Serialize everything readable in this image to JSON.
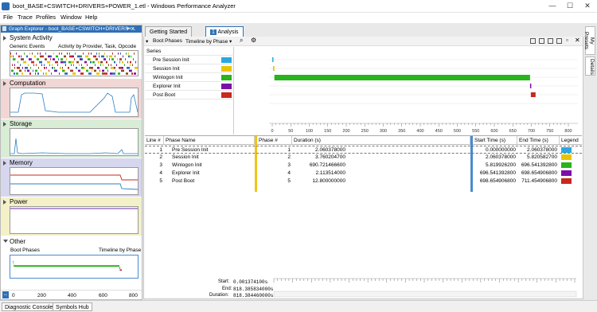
{
  "window": {
    "title": "boot_BASE+CSWITCH+DRIVERS+POWER_1.etl - Windows Performance Analyzer",
    "minimize": "—",
    "maximize": "☐",
    "close": "✕"
  },
  "menu": [
    "File",
    "Trace",
    "Profiles",
    "Window",
    "Help"
  ],
  "graph_explorer": {
    "title": "Graph Explorer - boot_BASE+CSWITCH+DRIVERS+...",
    "sections": {
      "system_activity": {
        "title": "System Activity",
        "sub_left": "Generic Events",
        "sub_right": "Activity by Provider, Task, Opcode"
      },
      "computation": {
        "title": "Computation"
      },
      "storage": {
        "title": "Storage"
      },
      "memory": {
        "title": "Memory"
      },
      "power": {
        "title": "Power"
      },
      "other": {
        "title": "Other",
        "graph_left": "Boot Phases",
        "graph_right": "Timeline by Phase"
      }
    },
    "axis_ticks": [
      "0",
      "200",
      "400",
      "600",
      "800"
    ]
  },
  "tabs": {
    "getting_started": "Getting Started",
    "analysis_num": "1",
    "analysis": "Analysis"
  },
  "graph": {
    "title": "Boot Phases",
    "preset": "Timeline by Phase",
    "series_header": "Series"
  },
  "series": [
    {
      "name": "Pre Session Init",
      "color": "#29a8e0"
    },
    {
      "name": "Session Init",
      "color": "#e8c400"
    },
    {
      "name": "Winlogon Init",
      "color": "#29b31c"
    },
    {
      "name": "Explorer Init",
      "color": "#7a10a8"
    },
    {
      "name": "Post Boot",
      "color": "#c8281e"
    }
  ],
  "chart_data": {
    "type": "bar",
    "title": "Boot Phases",
    "xlim": [
      0,
      800
    ],
    "x_ticks": [
      "0",
      "50",
      "100",
      "150",
      "200",
      "250",
      "300",
      "350",
      "400",
      "450",
      "500",
      "550",
      "600",
      "650",
      "700",
      "750",
      "800"
    ],
    "bars": [
      {
        "name": "Pre Session Init",
        "start": 0.0,
        "end": 2.060378
      },
      {
        "name": "Session Init",
        "start": 2.060378,
        "end": 5.820582
      },
      {
        "name": "Winlogon Init",
        "start": 5.819926,
        "end": 696.541392
      },
      {
        "name": "Explorer Init",
        "start": 696.541392,
        "end": 698.654906
      },
      {
        "name": "Post Boot",
        "start": 698.654906,
        "end": 711.454906
      }
    ]
  },
  "table": {
    "headers": {
      "line": "Line #",
      "phase_name": "Phase Name",
      "phase_num": "Phase #",
      "duration": "Duration (s)",
      "start": "Start Time (s)",
      "end": "End Time (s)",
      "legend": "Legend"
    },
    "rows": [
      {
        "line": "1",
        "name": "Pre Session Init",
        "phase": "1",
        "duration": "2.060378000",
        "start": "0.000000000",
        "end": "2.060378000"
      },
      {
        "line": "2",
        "name": "Session Init",
        "phase": "2",
        "duration": "3.760204700",
        "start": "2.060378000",
        "end": "5.820582700"
      },
      {
        "line": "3",
        "name": "Winlogon Init",
        "phase": "3",
        "duration": "690.721466600",
        "start": "5.819926200",
        "end": "696.541392800"
      },
      {
        "line": "4",
        "name": "Explorer Init",
        "phase": "4",
        "duration": "2.113514000",
        "start": "696.541392800",
        "end": "698.654906800"
      },
      {
        "line": "5",
        "name": "Post Boot",
        "phase": "5",
        "duration": "12.800000000",
        "start": "698.654906800",
        "end": "711.454906800"
      }
    ]
  },
  "selection": {
    "start_label": "Start:",
    "start": "0.001374100s",
    "end_label": "End:",
    "end": "818.385834000s",
    "duration_label": "Duration:",
    "duration": "818.384460000s"
  },
  "statusbar": {
    "diagnostic": "Diagnostic Console",
    "symbols": "Symbols Hub"
  },
  "right_tabs": {
    "presets": "My Presets",
    "details": "Details"
  }
}
